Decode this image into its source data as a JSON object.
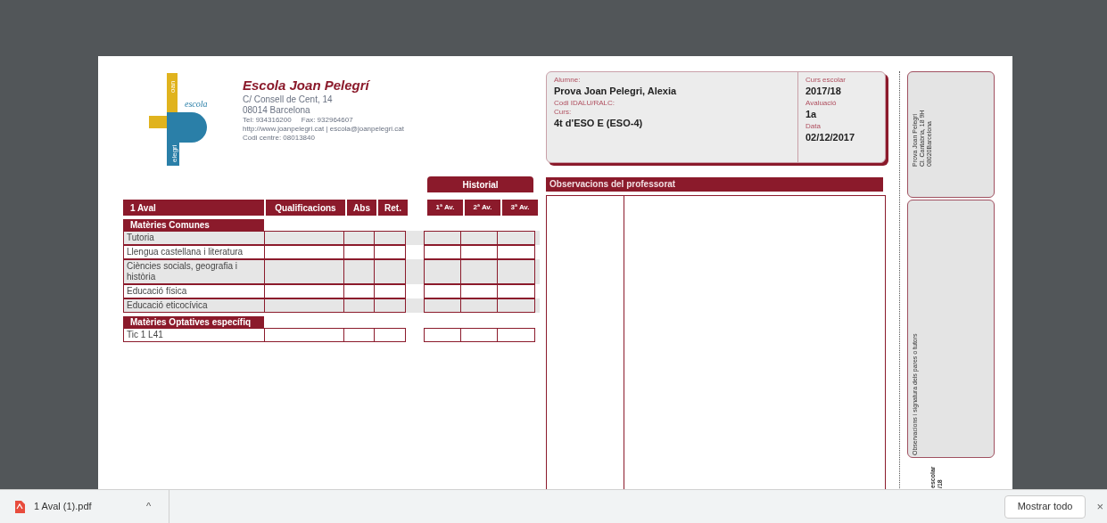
{
  "logo": {
    "top": "oan",
    "side": "escola",
    "bottom": "elegri"
  },
  "school": {
    "name": "Escola Joan Pelegrí",
    "lines": [
      "C/ Consell de Cent, 14",
      "08014 Barcelona",
      "Tel: 934316200     Fax: 932964607",
      "http://www.joanpelegri.cat | escola@joanpelegri.cat",
      "Codi centre: 08013840"
    ]
  },
  "student": {
    "left": [
      {
        "kind": "label",
        "text": "Alumne:"
      },
      {
        "kind": "value",
        "text": "Prova Joan Pelegri, Alexia"
      },
      {
        "kind": "label",
        "text": "Codi IDALU/RALC:"
      },
      {
        "kind": "label",
        "text": "Curs:"
      },
      {
        "kind": "value",
        "text": "4t d'ESO E (ESO-4)"
      }
    ],
    "right": [
      {
        "kind": "label",
        "text": "Curs escolar"
      },
      {
        "kind": "value",
        "text": "2017/18"
      },
      {
        "kind": "label",
        "text": "Avaluació"
      },
      {
        "kind": "value",
        "text": "1a"
      },
      {
        "kind": "label",
        "text": "Data"
      },
      {
        "kind": "value",
        "text": "02/12/2017"
      }
    ]
  },
  "historial_title": "Historial",
  "columns": [
    "1 Aval",
    "Qualificacions",
    "Abs",
    "Ret."
  ],
  "history_columns": [
    "1ª Av.",
    "2ª Av.",
    "3ª Av."
  ],
  "rows": [
    {
      "kind": "section",
      "text": "Matèries Comunes"
    },
    {
      "kind": "subject",
      "text": "Tutoria",
      "shaded": true
    },
    {
      "kind": "subject",
      "text": "Llengua castellana i literatura",
      "shaded": false
    },
    {
      "kind": "subject",
      "text": "Ciències socials, geografia i història",
      "shaded": true
    },
    {
      "kind": "subject",
      "text": "Educació física",
      "shaded": false
    },
    {
      "kind": "subject",
      "text": "Educació eticocívica",
      "shaded": true
    },
    {
      "kind": "section",
      "text": "Matèries Optatives específiq"
    },
    {
      "kind": "subject",
      "text": "Tic 1 L41",
      "shaded": false
    }
  ],
  "observations_title": "Observacions del professorat",
  "side": {
    "address": [
      "Prova Joan Pelegri",
      "Cl. Cantabria, 18 9H",
      "08020Barcelona"
    ],
    "signature": "Observacions i signatura dels pares o tutors",
    "cut": [
      "escolar",
      "/18"
    ]
  },
  "downloads": [
    {
      "name": "1 Aval (1).pdf",
      "caret": "^"
    }
  ],
  "show_all": "Mostrar todo",
  "close": "×"
}
